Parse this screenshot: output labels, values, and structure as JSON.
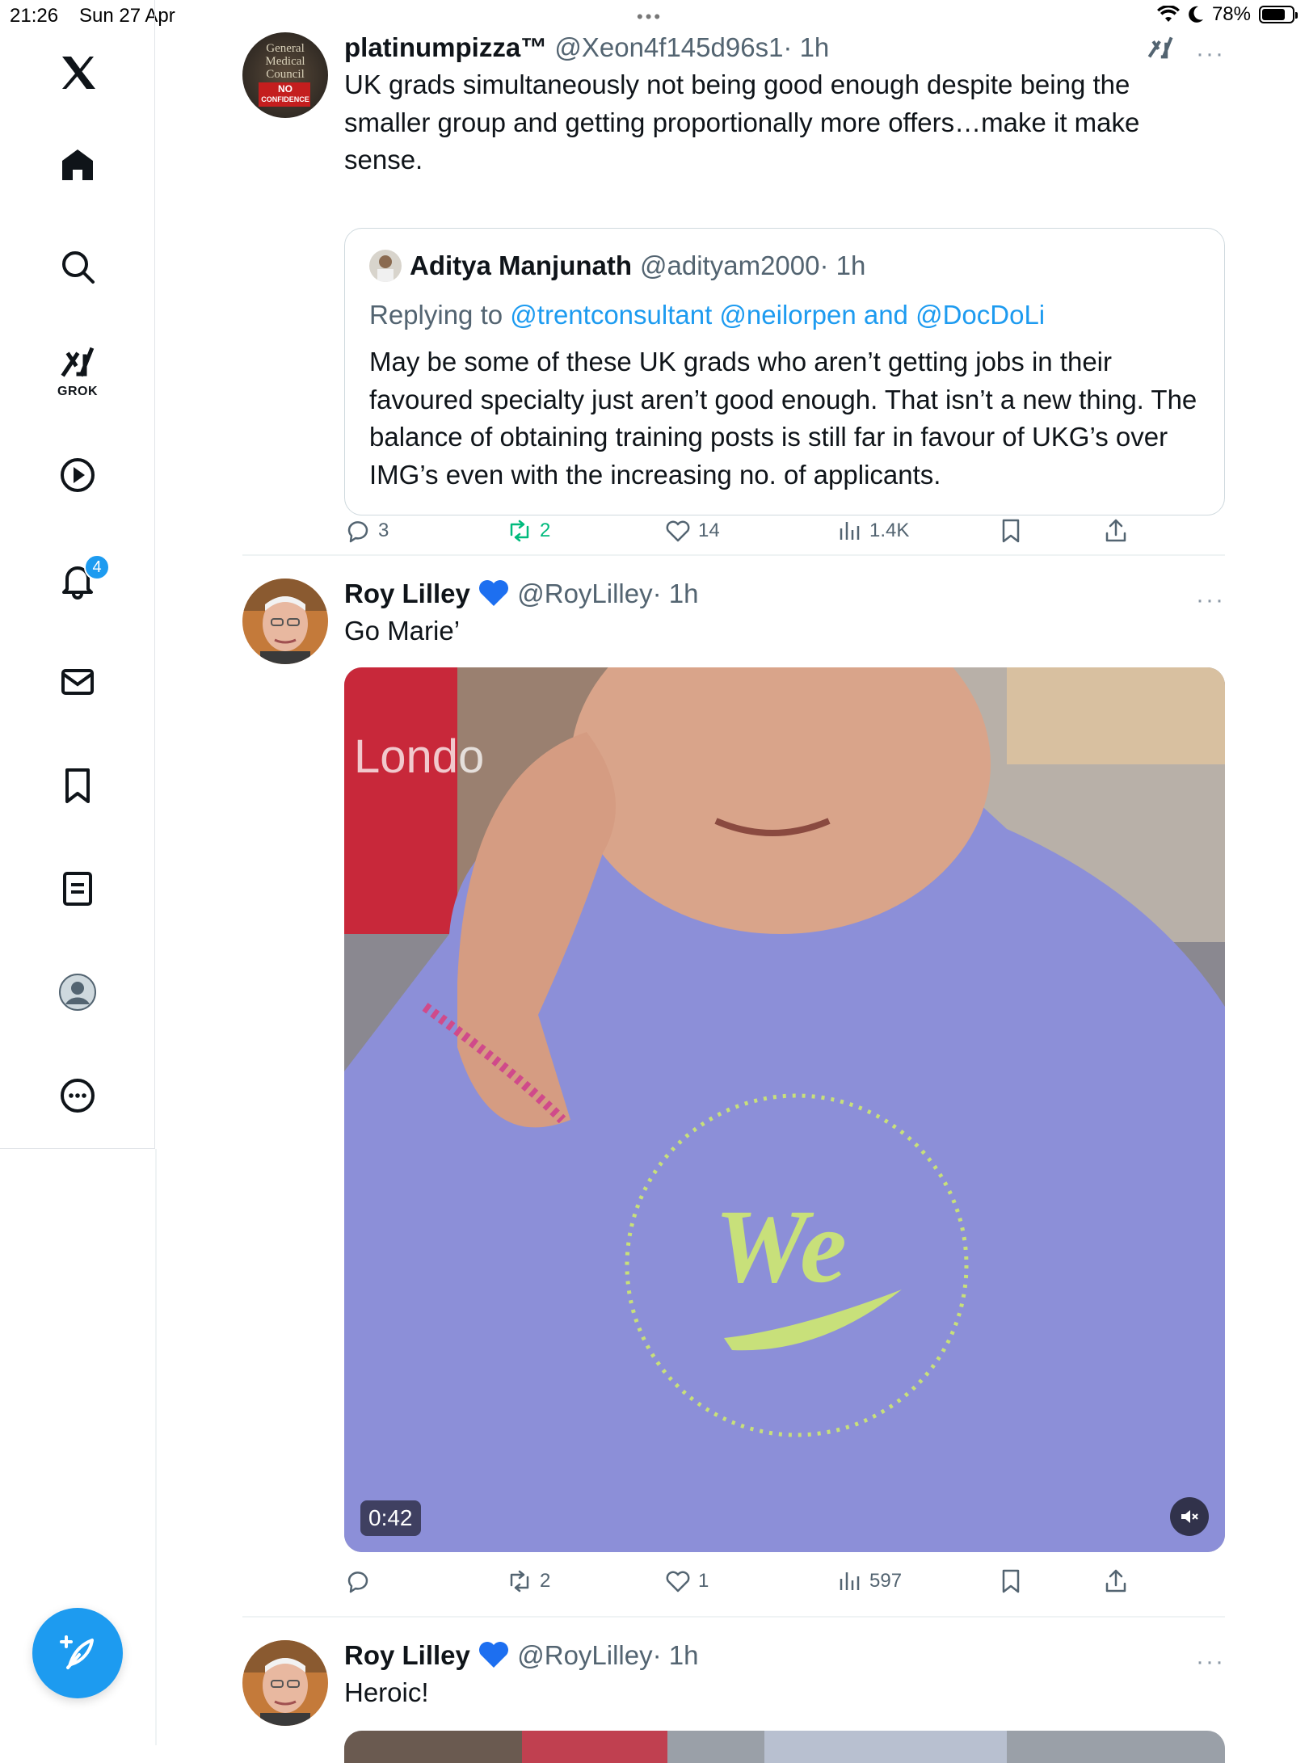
{
  "status_bar": {
    "time": "21:26",
    "date": "Sun 27 Apr",
    "battery": "78%",
    "battery_level": 0.78
  },
  "sidebar": {
    "grok_label": "GROK",
    "notification_count": "4",
    "items": [
      "x-logo",
      "home",
      "explore",
      "grok",
      "video",
      "notifications",
      "messages",
      "bookmarks",
      "lists",
      "profile",
      "more"
    ]
  },
  "colors": {
    "accent": "#1d9bf0",
    "repost_active": "#00ba7c",
    "muted_text": "#536471"
  },
  "posts": [
    {
      "author": "platinumpizza™",
      "handle": "@Xeon4f145d96s1",
      "time": "· 1h",
      "text": "UK grads simultaneously not being good enough despite being the smaller group and getting proportionally more offers…make it make sense.",
      "avatar_lines": [
        "General",
        "Medical",
        "Council",
        "NO",
        "CONFIDENCE"
      ],
      "quote": {
        "author": "Aditya Manjunath",
        "handle": "@adityam2000",
        "time": "· 1h",
        "replying_prefix": "Replying to",
        "replying_to": "@trentconsultant @neilorpen and @DocDoLi",
        "text": "May be some of these UK grads who aren’t getting jobs in their favoured specialty just aren’t good enough. That isn’t a new thing. The balance of obtaining training posts is still far in favour of UKG’s over IMG’s even with the increasing no. of applicants."
      },
      "actions": {
        "replies": "3",
        "reposts": "2",
        "likes": "14",
        "views": "1.4K"
      }
    },
    {
      "author": "Roy Lilley",
      "handle": "@RoyLilley",
      "time": "· 1h",
      "text": "Go Marie’",
      "video": {
        "duration": "0:42",
        "sign_text": "Londo"
      },
      "actions": {
        "replies": "",
        "reposts": "2",
        "likes": "1",
        "views": "597"
      }
    },
    {
      "author": "Roy Lilley",
      "handle": "@RoyLilley",
      "time": "· 1h",
      "text": "Heroic!"
    }
  ]
}
